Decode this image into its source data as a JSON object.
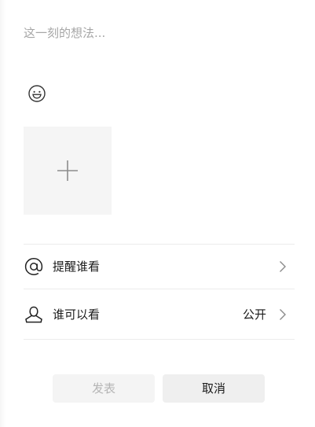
{
  "composer": {
    "placeholder": "这一刻的想法...",
    "value": ""
  },
  "icons": {
    "emoji": "smiley-face-icon",
    "add_photo": "plus-icon",
    "mention": "at-sign-icon",
    "visibility": "person-icon",
    "chevron": "chevron-right-icon"
  },
  "options": {
    "mention": {
      "label": "提醒谁看"
    },
    "visibility": {
      "label": "谁可以看",
      "value": "公开"
    }
  },
  "actions": {
    "publish_label": "发表",
    "publish_enabled": false,
    "cancel_label": "取消"
  },
  "colors": {
    "placeholder_text": "#a6a6a6",
    "disabled_text": "#b5b5b5",
    "button_bg": "#f2f2f2",
    "tile_bg": "#f5f5f5",
    "icon": "#333333"
  }
}
